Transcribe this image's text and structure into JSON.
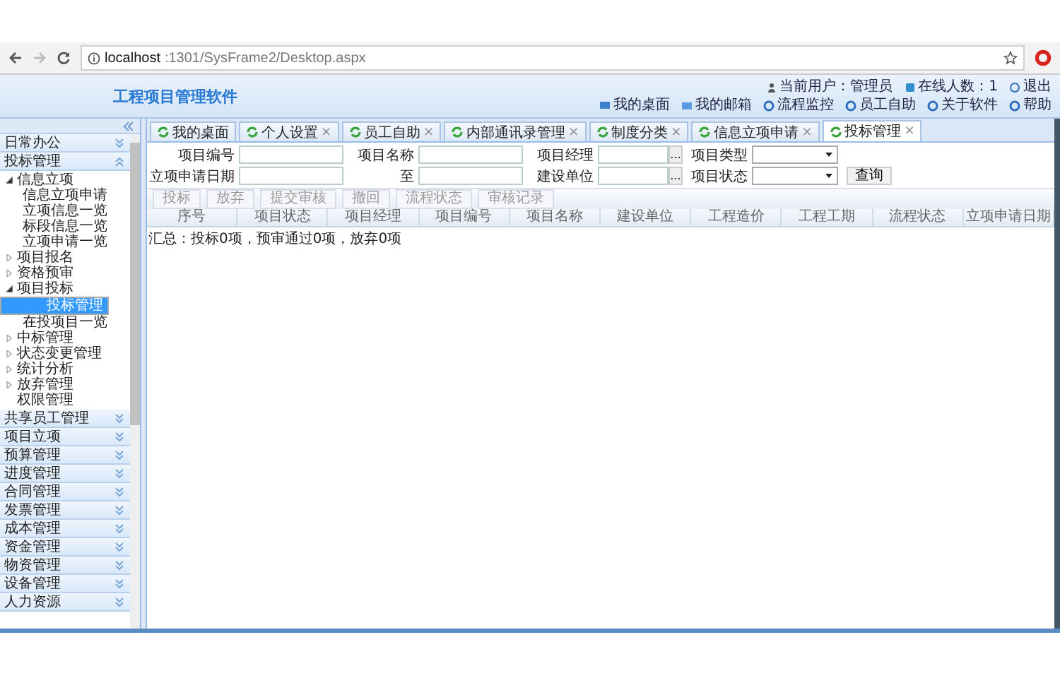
{
  "browser": {
    "url_host": "localhost",
    "url_path": ":1301/SysFrame2/Desktop.aspx"
  },
  "header": {
    "title": "工程项目管理软件",
    "status": [
      {
        "kind": "user",
        "text": "当前用户：管理员"
      },
      {
        "kind": "online",
        "text": "在线人数：1"
      },
      {
        "kind": "exit",
        "text": "退出"
      }
    ],
    "links": [
      {
        "kind": "desk",
        "text": "我的桌面"
      },
      {
        "kind": "mail",
        "text": "我的邮箱"
      },
      {
        "kind": "flow",
        "text": "流程监控"
      },
      {
        "kind": "staff",
        "text": "员工自助"
      },
      {
        "kind": "about",
        "text": "关于软件"
      },
      {
        "kind": "help",
        "text": "帮助"
      }
    ]
  },
  "sidebar": {
    "sections": [
      {
        "label": "日常办公",
        "expanded": false
      },
      {
        "label": "投标管理",
        "expanded": true,
        "items": [
          {
            "kind": "folder",
            "label": "信息立项",
            "expanded": true,
            "selected": false,
            "children": [
              {
                "label": "信息立项申请",
                "selected": false
              },
              {
                "label": "立项信息一览",
                "selected": false
              },
              {
                "label": "标段信息一览",
                "selected": false
              },
              {
                "label": "立项申请一览",
                "selected": false
              }
            ]
          },
          {
            "kind": "folder",
            "label": "项目报名",
            "expanded": false,
            "selected": false
          },
          {
            "kind": "folder",
            "label": "资格预审",
            "expanded": false,
            "selected": false
          },
          {
            "kind": "folder",
            "label": "项目投标",
            "expanded": true,
            "selected": false,
            "children": [
              {
                "label": "投标管理",
                "selected": true
              },
              {
                "label": "在投项目一览",
                "selected": false
              }
            ]
          },
          {
            "kind": "folder",
            "label": "中标管理",
            "expanded": false,
            "selected": false
          },
          {
            "kind": "folder",
            "label": "状态变更管理",
            "expanded": false,
            "selected": false
          },
          {
            "kind": "folder",
            "label": "统计分析",
            "expanded": false,
            "selected": false
          },
          {
            "kind": "folder",
            "label": "放弃管理",
            "expanded": false,
            "selected": false
          },
          {
            "kind": "page",
            "label": "权限管理",
            "selected": false
          }
        ]
      },
      {
        "label": "共享员工管理",
        "expanded": false
      },
      {
        "label": "项目立项",
        "expanded": false
      },
      {
        "label": "预算管理",
        "expanded": false
      },
      {
        "label": "进度管理",
        "expanded": false
      },
      {
        "label": "合同管理",
        "expanded": false
      },
      {
        "label": "发票管理",
        "expanded": false
      },
      {
        "label": "成本管理",
        "expanded": false
      },
      {
        "label": "资金管理",
        "expanded": false
      },
      {
        "label": "物资管理",
        "expanded": false
      },
      {
        "label": "设备管理",
        "expanded": false
      },
      {
        "label": "人力资源",
        "expanded": false
      }
    ]
  },
  "tabs": [
    {
      "label": "我的桌面",
      "selected": false
    },
    {
      "label": "个人设置",
      "selected": false,
      "close": "×"
    },
    {
      "label": "员工自助",
      "selected": false,
      "close": "×"
    },
    {
      "label": "内部通讯录管理",
      "selected": false,
      "close": "×"
    },
    {
      "label": "制度分类",
      "selected": false,
      "close": "×"
    },
    {
      "label": "信息立项申请",
      "selected": false,
      "close": "×"
    },
    {
      "label": "投标管理",
      "selected": true,
      "close": "×"
    }
  ],
  "filters": [
    [
      {
        "kind": "text",
        "label": "项目编号"
      },
      {
        "kind": "text",
        "label": "项目名称"
      },
      {
        "kind": "picker",
        "label": "项目经理",
        "button": "..."
      },
      {
        "kind": "select",
        "label": "项目类型"
      }
    ],
    [
      {
        "kind": "text",
        "label": "立项申请日期"
      },
      {
        "kind": "text",
        "label": "至"
      },
      {
        "kind": "picker",
        "label": "建设单位",
        "button": "..."
      },
      {
        "kind": "select",
        "label": "项目状态"
      },
      {
        "kind": "button",
        "label": "查询"
      }
    ]
  ],
  "toolbar": [
    {
      "label": "投标",
      "disabled": true
    },
    {
      "label": "放弃",
      "disabled": true
    },
    {
      "label": "提交审核",
      "disabled": true
    },
    {
      "label": "撤回",
      "disabled": true
    },
    {
      "label": "流程状态",
      "disabled": true
    },
    {
      "label": "审核记录",
      "disabled": true
    }
  ],
  "table": {
    "columns": [
      "序号",
      "项目状态",
      "项目经理",
      "项目编号",
      "项目名称",
      "建设单位",
      "工程造价",
      "工程工期",
      "流程状态",
      "立项申请日期"
    ]
  },
  "summary": "汇总：投标0项，预审通过0项，放弃0项"
}
